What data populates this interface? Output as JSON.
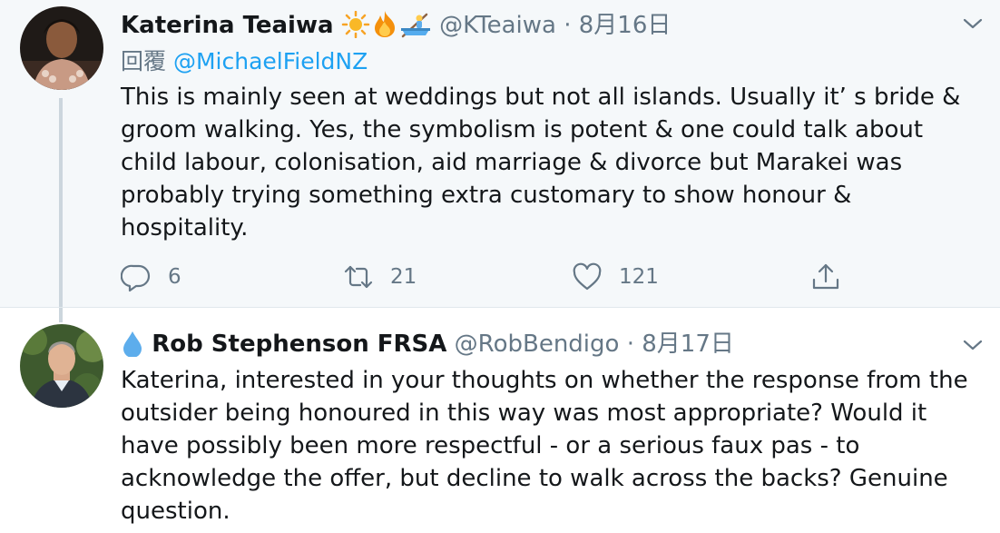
{
  "tweets": [
    {
      "name": "Katerina Teaiwa",
      "emojis": [
        "sun-icon",
        "fire-icon",
        "rowboat-icon"
      ],
      "handle": "@KTeaiwa",
      "separator": "·",
      "date": "8月16日",
      "reply_prefix": "回覆",
      "reply_mention": "@MichaelFieldNZ",
      "text_lines": [
        "This is mainly seen at weddings but not all islands. Usually it’  s bride &",
        "groom walking. Yes, the symbolism is potent & one could talk about",
        "child labour, colonisation, aid marriage & divorce but Marakei was",
        "probably trying something extra customary to show honour &",
        "hospitality."
      ],
      "actions": {
        "reply_count": "6",
        "retweet_count": "21",
        "like_count": "121"
      }
    },
    {
      "name_prefix_icon": "droplet-icon",
      "name": "Rob Stephenson FRSA",
      "handle": "@RobBendigo",
      "separator": "·",
      "date": "8月17日",
      "text_lines": [
        "Katerina, interested in your thoughts on whether the response from the",
        "outsider being honoured in this way was most appropriate? Would it",
        "have possibly been more respectful - or a serious faux pas - to",
        "acknowledge the offer, but decline to walk across the backs? Genuine",
        "question."
      ]
    }
  ],
  "colors": {
    "accent": "#1da1f2",
    "muted": "#657786",
    "text": "#14171a",
    "highlight_bg": "#f5f8fa"
  }
}
